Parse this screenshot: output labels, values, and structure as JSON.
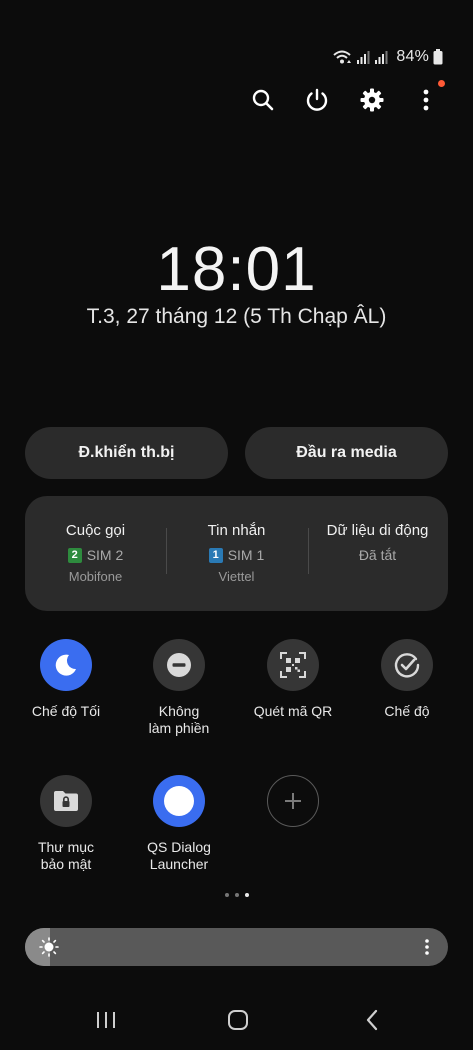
{
  "status_bar": {
    "battery_percent": "84%",
    "icons": [
      "wifi-icon",
      "signal-sim1-icon",
      "signal-sim2-icon",
      "battery-icon"
    ]
  },
  "top_actions": {
    "icons": [
      "search-icon",
      "power-icon",
      "gear-icon",
      "more-vertical-icon"
    ],
    "notification_dot_color": "#ff5a36"
  },
  "clock": {
    "time": "18:01",
    "date": "T.3, 27 tháng 12 (5 Th Chạp ÂL)"
  },
  "buttons": {
    "device_control": "Đ.khiển th.bị",
    "media_output": "Đầu ra media"
  },
  "sim_panel": {
    "calls": {
      "title": "Cuộc gọi",
      "sim_number": "2",
      "sim_label": "SIM 2",
      "carrier": "Mobifone",
      "badge_color": "#2e8b3e"
    },
    "messages": {
      "title": "Tin nhắn",
      "sim_number": "1",
      "sim_label": "SIM 1",
      "carrier": "Viettel",
      "badge_color": "#2a7ab5"
    },
    "mobile_data": {
      "title": "Dữ liệu di động",
      "status": "Đã tắt"
    }
  },
  "tiles": [
    {
      "label": "Chế độ Tối",
      "icon": "moon-icon",
      "active": true
    },
    {
      "label": "Không\nlàm phiền",
      "icon": "do-not-disturb-icon",
      "active": false
    },
    {
      "label": "Quét mã QR",
      "icon": "qr-scan-icon",
      "active": false
    },
    {
      "label": "Chế độ",
      "icon": "modes-icon",
      "active": false
    },
    {
      "label": "Thư mục\nbảo mật",
      "icon": "secure-folder-icon",
      "active": false
    },
    {
      "label": "QS Dialog\nLauncher",
      "icon": "circle-icon",
      "active": true
    },
    {
      "label": "",
      "icon": "add-icon",
      "active": false
    }
  ],
  "pager": {
    "pages": 3,
    "current_page": 3
  },
  "brightness": {
    "level": 0.06
  },
  "navbar": {
    "icons": [
      "recents-icon",
      "home-icon",
      "back-icon"
    ]
  },
  "colors": {
    "accent": "#3a6df0",
    "background": "#0c0c0c",
    "panel": "#2b2b2b"
  }
}
